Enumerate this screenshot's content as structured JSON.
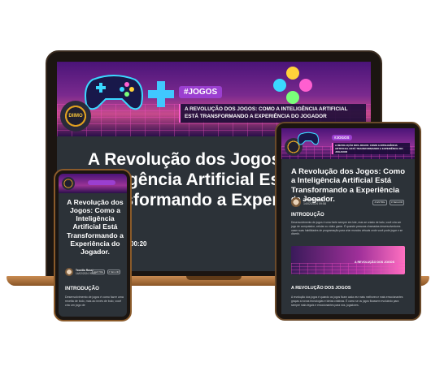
{
  "laptop": {
    "tag": "#JOGOS",
    "banner_headline": "A Revolução dos Jogos: Como a Inteligência Artificial Está Transformando a Experiência do Jogador",
    "logo": "DIIMO",
    "title": "A Revolução dos Jogos: Como a Inteligência Artificial Está Transformando a Experiência",
    "time": "00:20"
  },
  "tablet": {
    "tag": "#JOGOS",
    "banner_headline": "A Revolução dos Jogos: Como a Inteligência Artificial Está Transformando a Experiência do Jogador",
    "title": "A Revolução dos Jogos: Como a Inteligência Artificial Está Transformando a Experiência do Jogador.",
    "author_name": "Tecnõlo Rossi",
    "author_date": "14/02/2024 09:58",
    "btn_share": "# ENTRE",
    "btn_follow": "# SEGUIR",
    "intro_heading": "INTRODUÇÃO",
    "intro_text": "Desenvolvimento de jogos é uma fonte sempre em lote, mas se criado de lado, você cria um jogo de computador, celular ou vídeo game. É quando pessoas chamadas desenvolvedores usam suas habilidades de programação para criar mundos virtuais onde você pode jogar e se divertir.",
    "image_caption": "A REVOLUÇÃO DOS JOGOS",
    "section_heading": "A REVOLUÇÃO DOS JOGOS",
    "section_text": "A revolução dos jogos é quando os jogos ficam cada vez mais melhores e mais emocionantes graças a novas tecnologias e ideias criativas. É como se os jogos ficassem evoluindo para sempre mais legais e emocionantes para nós, jogadores."
  },
  "phone": {
    "title": "A Revolução dos Jogos: Como a Inteligência Artificial Está Transformando a Experiência do Jogador.",
    "author_name": "Tecnõlo Rossi",
    "author_date": "14/02/2024 09:58",
    "btn_share": "# ENTRE",
    "btn_follow": "# SEGUIR",
    "intro_heading": "INTRODUÇÃO",
    "intro_text": "Desenvolvimento de jogos é como fazer uma receita de bolo, mas ao invés de bolo, você cria um jogo de"
  },
  "colors": {
    "screen_bg": "#2c3238",
    "accent": "#9b3fd0",
    "frame": "#1b1511",
    "laptop_base": "#c98b52"
  }
}
